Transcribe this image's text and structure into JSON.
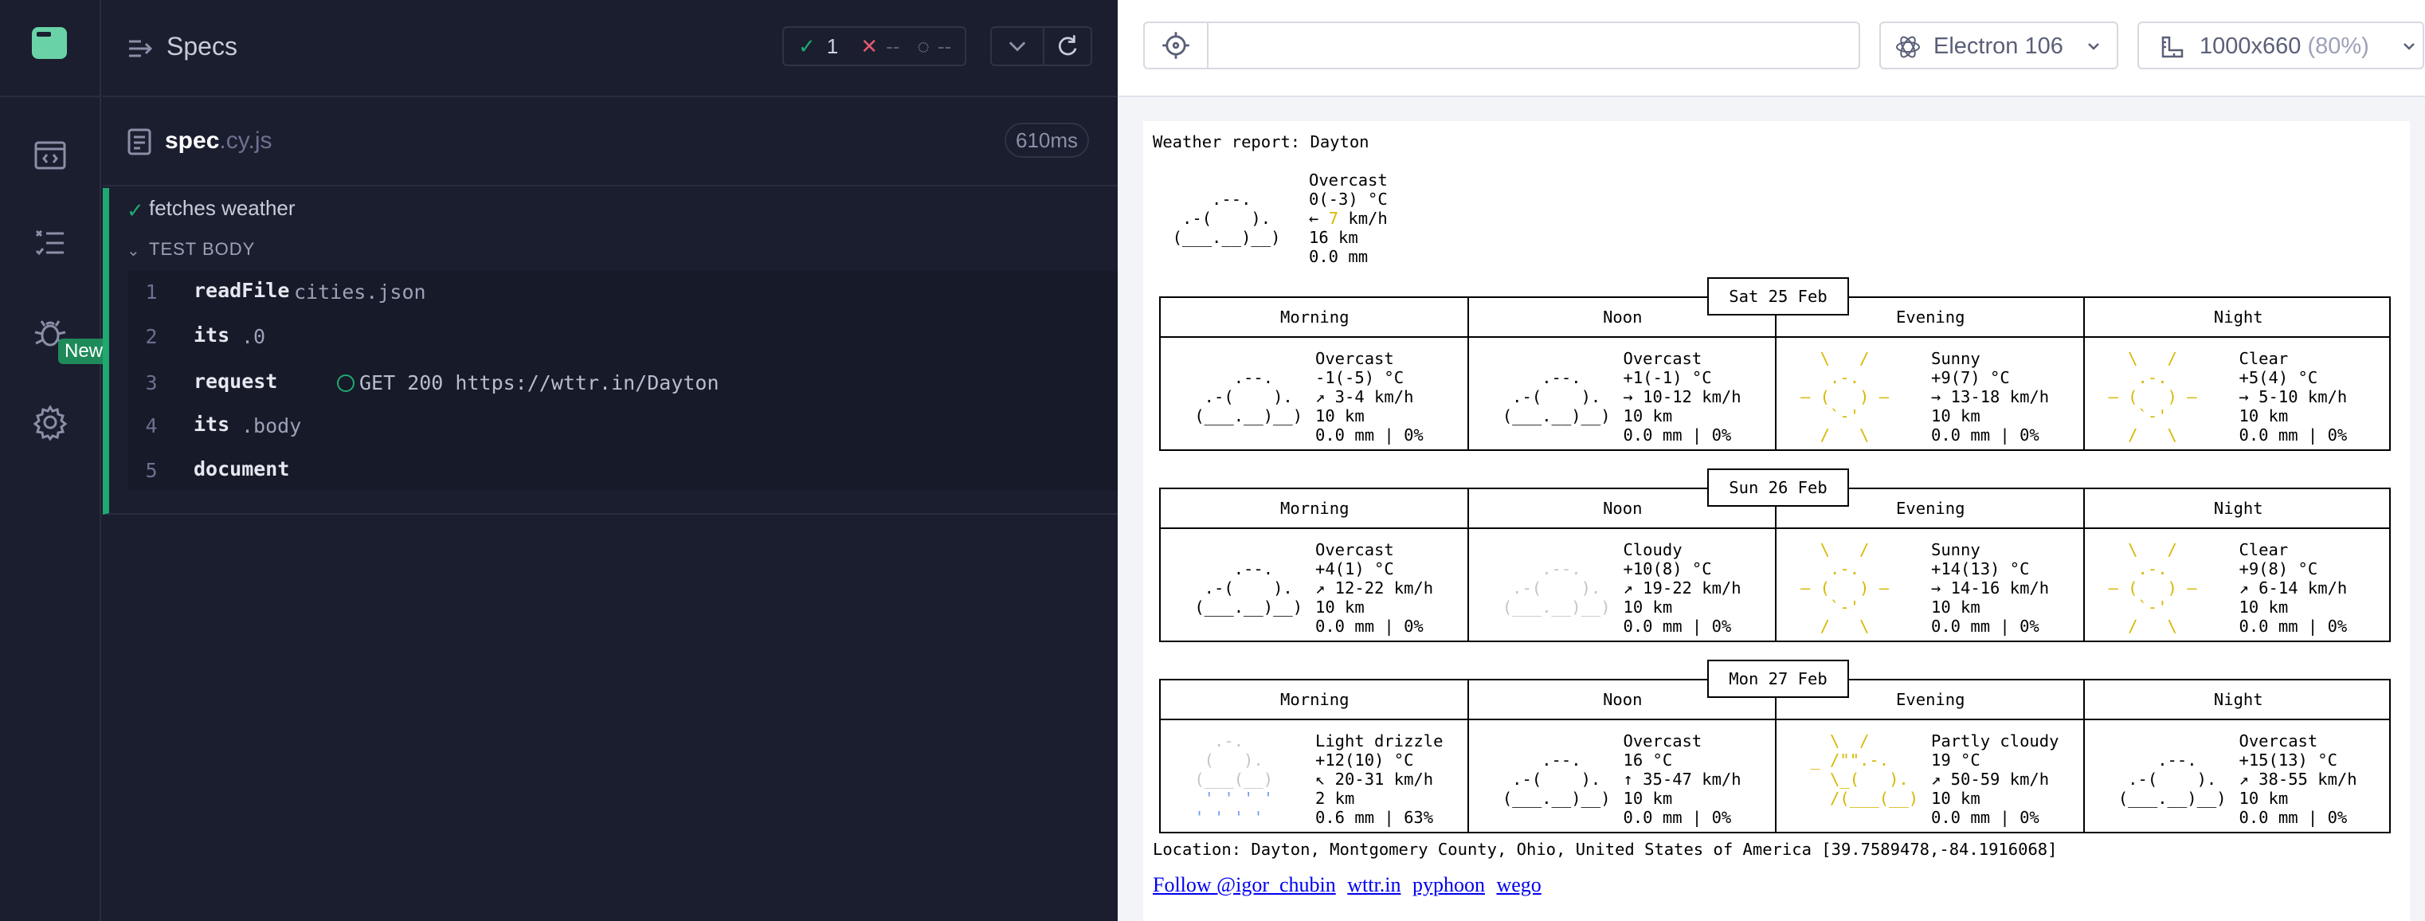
{
  "app": {
    "icons": [
      "cypress-logo",
      "specs-icon",
      "runs-icon",
      "debug-icon",
      "settings-icon"
    ],
    "new_badge": "New"
  },
  "reporter": {
    "title": "Specs",
    "stats": {
      "passed": "1",
      "failed": "--",
      "pending": "--"
    },
    "spec": {
      "name": "spec",
      "ext": ".cy.js",
      "duration": "610ms"
    },
    "test": {
      "title": "fetches weather",
      "body_label": "TEST BODY",
      "commands": [
        {
          "num": "1",
          "name": "readFile",
          "message": "cities.json"
        },
        {
          "num": "2",
          "name": "its",
          "message": ".0"
        },
        {
          "num": "3",
          "name": "request",
          "message": "GET 200 https://wttr.in/Dayton"
        },
        {
          "num": "4",
          "name": "its",
          "message": ".body"
        },
        {
          "num": "5",
          "name": "document",
          "message": ""
        }
      ]
    }
  },
  "preview": {
    "url": "",
    "browser": "Electron 106",
    "viewport": "1000x660",
    "viewport_scale": "(80%)"
  },
  "weather": {
    "title": "Weather report: Dayton",
    "current": {
      "cond": "Overcast",
      "temp": "0(-3) °C",
      "wind_dir": "←",
      "wind": "7",
      "wind_unit": "km/h",
      "vis": "16 km",
      "precip": "0.0 mm"
    },
    "periods": [
      "Morning",
      "Noon",
      "Evening",
      "Night"
    ],
    "days": [
      {
        "date": "Sat 25 Feb",
        "cells": [
          {
            "cond": "Overcast",
            "temp": "-1(-5) °C",
            "wind": "↗ 3-4 km/h",
            "vis": "10 km",
            "precip": "0.0 mm | 0%"
          },
          {
            "cond": "Overcast",
            "temp": "+1(-1) °C",
            "wind": "→ 10-12 km/h",
            "vis": "10 km",
            "precip": "0.0 mm | 0%"
          },
          {
            "cond": "Sunny",
            "temp": "+9(7) °C",
            "wind": "→ 13-18 km/h",
            "vis": "10 km",
            "precip": "0.0 mm | 0%"
          },
          {
            "cond": "Clear",
            "temp": "+5(4) °C",
            "wind": "→ 5-10 km/h",
            "vis": "10 km",
            "precip": "0.0 mm | 0%"
          }
        ]
      },
      {
        "date": "Sun 26 Feb",
        "cells": [
          {
            "cond": "Overcast",
            "temp": "+4(1) °C",
            "wind": "↗ 12-22 km/h",
            "vis": "10 km",
            "precip": "0.0 mm | 0%"
          },
          {
            "cond": "Cloudy",
            "temp": "+10(8) °C",
            "wind": "↗ 19-22 km/h",
            "vis": "10 km",
            "precip": "0.0 mm | 0%"
          },
          {
            "cond": "Sunny",
            "temp": "+14(13) °C",
            "wind": "→ 14-16 km/h",
            "vis": "10 km",
            "precip": "0.0 mm | 0%"
          },
          {
            "cond": "Clear",
            "temp": "+9(8) °C",
            "wind": "↗ 6-14 km/h",
            "vis": "10 km",
            "precip": "0.0 mm | 0%"
          }
        ]
      },
      {
        "date": "Mon 27 Feb",
        "cells": [
          {
            "cond": "Light drizzle",
            "temp": "+12(10) °C",
            "wind": "↖ 20-31 km/h",
            "vis": "2 km",
            "precip": "0.6 mm | 63%"
          },
          {
            "cond": "Overcast",
            "temp": "16 °C",
            "wind": "↑ 35-47 km/h",
            "vis": "10 km",
            "precip": "0.0 mm | 0%"
          },
          {
            "cond": "Partly cloudy",
            "temp": "19 °C",
            "wind": "↗ 50-59 km/h",
            "vis": "10 km",
            "precip": "0.0 mm | 0%"
          },
          {
            "cond": "Overcast",
            "temp": "+15(13) °C",
            "wind": "↗ 38-55 km/h",
            "vis": "10 km",
            "precip": "0.0 mm | 0%"
          }
        ]
      }
    ],
    "location": "Location: Dayton, Montgomery County, Ohio, United States of America [39.7589478,-84.1916068]",
    "links": [
      "Follow @igor_chubin",
      "wttr.in",
      "pyphoon",
      "wego"
    ]
  }
}
